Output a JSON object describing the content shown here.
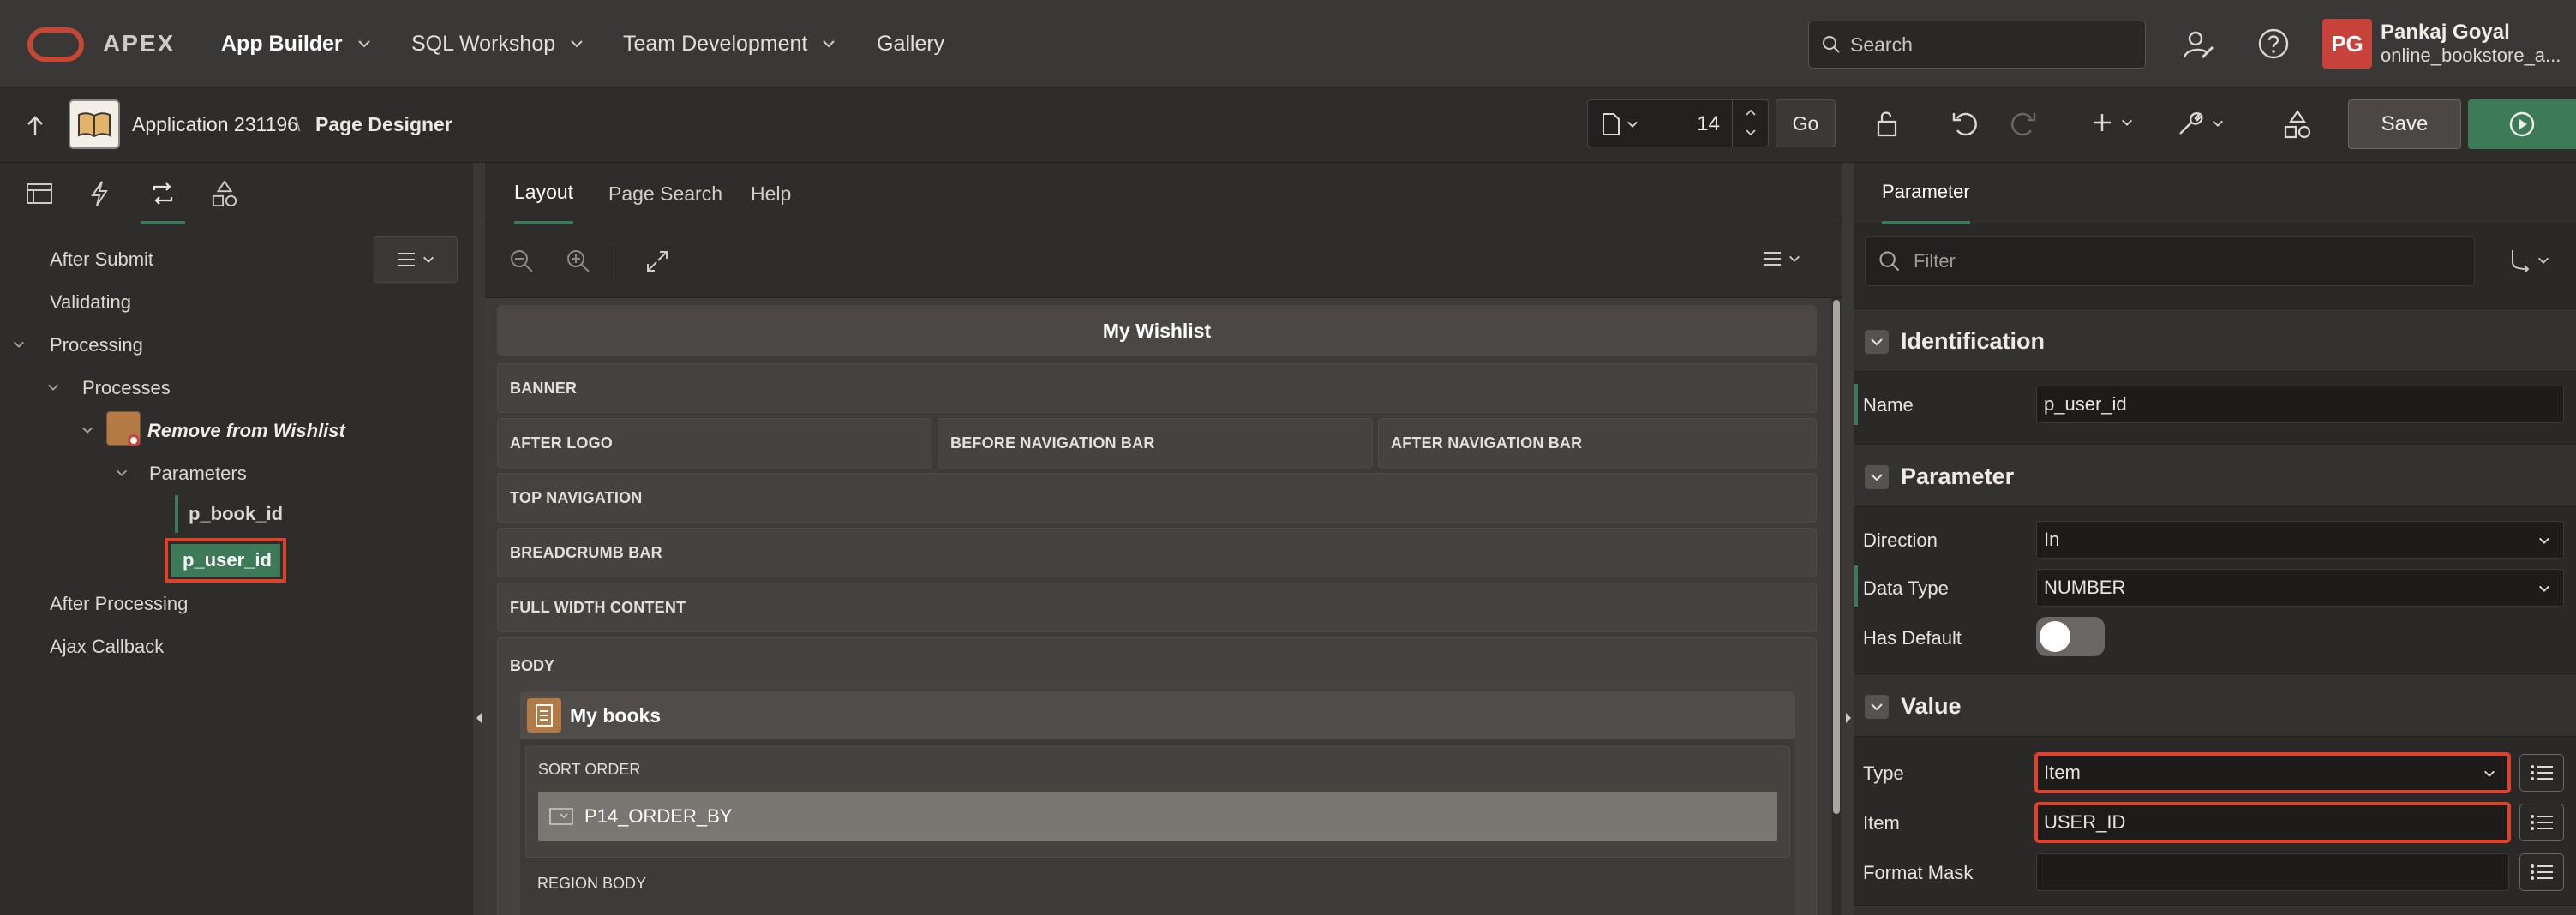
{
  "topbar": {
    "brand": "APEX",
    "menus": [
      "App Builder",
      "SQL Workshop",
      "Team Development",
      "Gallery"
    ],
    "search_placeholder": "Search",
    "user": {
      "initials": "PG",
      "name": "Pankaj Goyal",
      "workspace": "online_bookstore_a..."
    }
  },
  "secbar": {
    "app_label": "Application 231196",
    "separator": "\\",
    "page_label": "Page Designer",
    "page_number": "14",
    "go_label": "Go",
    "save_label": "Save"
  },
  "left": {
    "tree": {
      "after_submit": "After Submit",
      "validating": "Validating",
      "processing": "Processing",
      "processes": "Processes",
      "process_name": "Remove from Wishlist",
      "parameters": "Parameters",
      "param1": "p_book_id",
      "param2": "p_user_id",
      "after_processing": "After Processing",
      "ajax_callback": "Ajax Callback"
    }
  },
  "center": {
    "tabs": [
      "Layout",
      "Page Search",
      "Help"
    ],
    "page_title": "My Wishlist",
    "slots": {
      "banner": "BANNER",
      "after_logo": "AFTER LOGO",
      "before_nav": "BEFORE NAVIGATION BAR",
      "after_nav": "AFTER NAVIGATION BAR",
      "top_nav": "TOP NAVIGATION",
      "breadcrumb": "BREADCRUMB BAR",
      "full_width": "FULL WIDTH CONTENT",
      "body": "BODY"
    },
    "region": {
      "title": "My books",
      "sort_order": "SORT ORDER",
      "item": "P14_ORDER_BY",
      "region_body": "REGION BODY"
    }
  },
  "right": {
    "tab": "Parameter",
    "filter_placeholder": "Filter",
    "sections": {
      "identification": "Identification",
      "parameter": "Parameter",
      "value": "Value"
    },
    "props": {
      "name_label": "Name",
      "name_value": "p_user_id",
      "direction_label": "Direction",
      "direction_value": "In",
      "datatype_label": "Data Type",
      "datatype_value": "NUMBER",
      "hasdefault_label": "Has Default",
      "type_label": "Type",
      "type_value": "Item",
      "item_label": "Item",
      "item_value": "USER_ID",
      "format_label": "Format Mask",
      "format_value": ""
    }
  },
  "colors": {
    "accent_green": "#3d7a57",
    "highlight_red": "#e0412b",
    "brand_red": "#c74634",
    "avatar_red": "#c7423b"
  }
}
